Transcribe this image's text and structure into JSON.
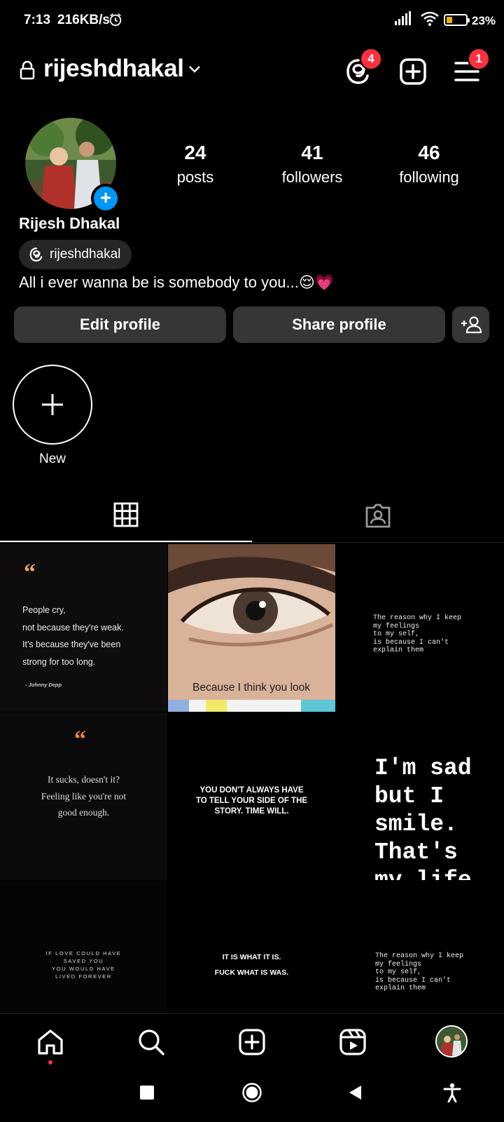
{
  "status_bar": {
    "time": "7:13",
    "net_speed": "216KB/s",
    "battery": "23%"
  },
  "header": {
    "username": "rijeshdhakal",
    "threads_badge": "4",
    "menu_badge": "1"
  },
  "profile": {
    "stats": [
      {
        "value": "24",
        "label": "posts"
      },
      {
        "value": "41",
        "label": "followers"
      },
      {
        "value": "46",
        "label": "following"
      }
    ],
    "full_name": "Rijesh Dhakal",
    "threads_handle": "rijeshdhakal",
    "bio": "All i ever wanna be is somebody to you...😌💗"
  },
  "buttons": {
    "edit_profile": "Edit profile",
    "share_profile": "Share profile"
  },
  "highlights": {
    "new_label": "New"
  },
  "posts": {
    "p1_quote": "“",
    "p1_lines": [
      "People cry,",
      "not because they're weak.",
      "It's because they've been",
      "strong for too long."
    ],
    "p1_author": "- Johnny Depp",
    "p2_caption": "Because I think you look",
    "p3_text": [
      "The reason why I keep",
      "my feelings",
      "to my self,",
      "is because I can't",
      "explain them"
    ],
    "p4_quote": "“",
    "p4_lines": [
      "It sucks, doesn't it?",
      "Feeling like you're not",
      "good enough."
    ],
    "p5_lines": [
      "YOU DON'T ALWAYS HAVE",
      "TO TELL YOUR SIDE OF THE",
      "STORY. TIME WILL."
    ],
    "p6_lines": [
      "I'm sad",
      "but I",
      "smile.",
      "That's",
      "my life"
    ],
    "p7_lines": [
      "IF LOVE COULD HAVE",
      "SAVED YOU",
      "YOU WOULD HAVE",
      "LIVED FOREVER"
    ],
    "p8_lines": [
      "IT IS WHAT IT IS.",
      "FUCK WHAT IS WAS."
    ],
    "p9_text": [
      "The reason why I keep",
      "my feelings",
      "to my self,",
      "is because I can't",
      "explain them"
    ]
  },
  "colors": {
    "badge": "#ff3040",
    "accent_blue": "#0095f6",
    "button_bg": "#363636"
  }
}
